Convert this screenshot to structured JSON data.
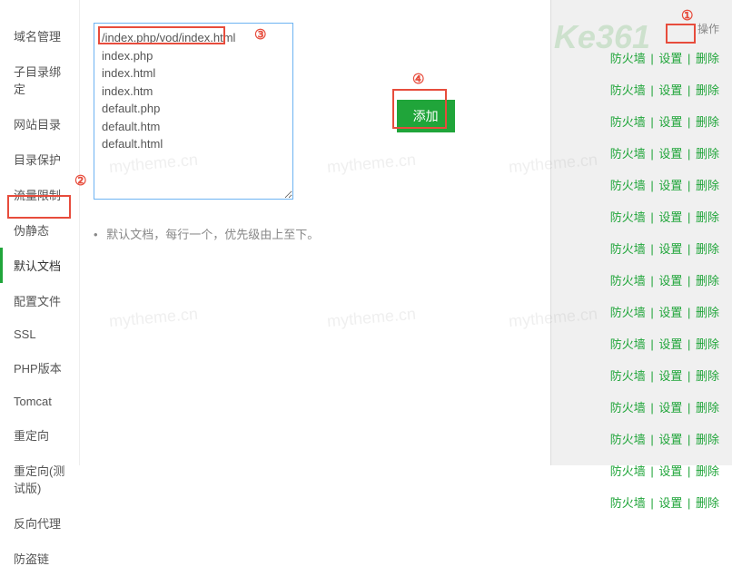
{
  "sidebar": {
    "items": [
      {
        "label": "域名管理"
      },
      {
        "label": "子目录绑定"
      },
      {
        "label": "网站目录"
      },
      {
        "label": "目录保护"
      },
      {
        "label": "流量限制"
      },
      {
        "label": "伪静态"
      },
      {
        "label": "默认文档"
      },
      {
        "label": "配置文件"
      },
      {
        "label": "SSL"
      },
      {
        "label": "PHP版本"
      },
      {
        "label": "Tomcat"
      },
      {
        "label": "重定向"
      },
      {
        "label": "重定向(测试版)"
      },
      {
        "label": "反向代理"
      },
      {
        "label": "防盗链"
      }
    ],
    "active_index": 6
  },
  "main": {
    "textarea_value": "/index.php/vod/index.html\nindex.php\nindex.html\nindex.htm\ndefault.php\ndefault.htm\ndefault.html",
    "add_button": "添加",
    "hint_bullet": "•",
    "hint_text": "默认文档，每行一个，优先级由上至下。"
  },
  "right": {
    "header": "操作",
    "firewall": "防火墙",
    "settings": "设置",
    "delete": "删除",
    "sep": " | ",
    "row_count": 15
  },
  "annotations": {
    "a1": "①",
    "a2": "②",
    "a3": "③",
    "a4": "④"
  },
  "watermark": {
    "text": "mytheme.cn",
    "logo": "Ke361"
  }
}
